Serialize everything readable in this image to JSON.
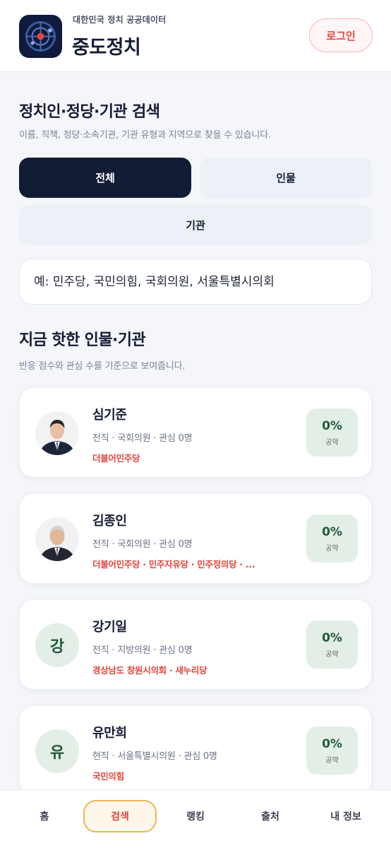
{
  "header": {
    "subtitle": "대한민국 정치 공공데이터",
    "title": "중도정치",
    "login_label": "로그인",
    "icon": "compass-logo-icon"
  },
  "search_section": {
    "title": "정치인·정당·기관 검색",
    "description": "이름, 직책, 정당·소속기관, 기관 유형과 지역으로 찾을 수 있습니다.",
    "tabs": [
      {
        "label": "전체",
        "selected": true
      },
      {
        "label": "인물",
        "selected": false
      },
      {
        "label": "기관",
        "selected": false
      }
    ],
    "search_placeholder": "예: 민주당, 국민의힘, 국회의원, 서울특별시의회"
  },
  "trending_section": {
    "title": "지금 핫한 인물·기관",
    "description": "반응 점수와 관심 수를 기준으로 보여줍니다.",
    "items": [
      {
        "name": "심기준",
        "meta": "전직 · 국회의원 · 관심 0명",
        "party": "더불어민주당",
        "avatar": "photo",
        "pledge_pct": "0%",
        "pledge_label": "공약"
      },
      {
        "name": "김종인",
        "meta": "전직 · 국회의원 · 관심 0명",
        "party": "더불어민주당 · 민주자유당 · 민주정의당 · ...",
        "avatar": "photo",
        "pledge_pct": "0%",
        "pledge_label": "공약"
      },
      {
        "name": "강기일",
        "meta": "전직 · 지방의원 · 관심 0명",
        "party": "경상남도 창원시의회 · 새누리당",
        "avatar": "initial",
        "initial": "강",
        "pledge_pct": "0%",
        "pledge_label": "공약"
      },
      {
        "name": "유만희",
        "meta": "현직 · 서울특별시의원 · 관심 0명",
        "party": "국민의힘",
        "avatar": "initial",
        "initial": "유",
        "pledge_pct": "0%",
        "pledge_label": "공약"
      }
    ]
  },
  "bottom_nav": {
    "items": [
      {
        "label": "홈",
        "selected": false
      },
      {
        "label": "검색",
        "selected": true
      },
      {
        "label": "랭킹",
        "selected": false
      },
      {
        "label": "출처",
        "selected": false
      },
      {
        "label": "내 정보",
        "selected": false
      }
    ]
  },
  "colors": {
    "primary_dark": "#131c35",
    "accent_red": "#e3463e",
    "pledge_green": "#1f5a38",
    "nav_active_border": "#f0b454"
  }
}
